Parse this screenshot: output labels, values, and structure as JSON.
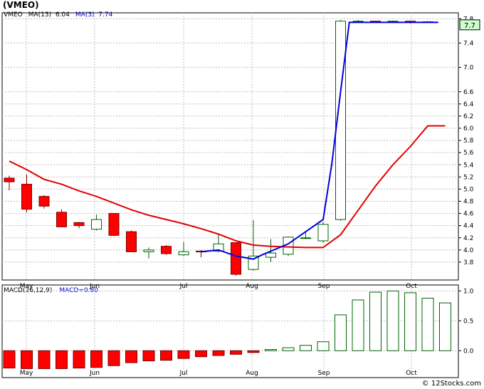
{
  "ticker": "(VMEO)",
  "legend": {
    "symbol": "VMEO",
    "ma13_label": "MA(13)",
    "ma13_value": "6.04",
    "ma3_label": "MA(3)",
    "ma3_value": "7.74",
    "last_price_label": "7.7"
  },
  "macd_legend": {
    "label": "MACD(26,12,9)",
    "value_label": "MACD=0.80"
  },
  "credit": "© 12Stocks.com",
  "colors": {
    "up_candle": "#ffffff",
    "up_border": "#006400",
    "down_candle": "#ff0000",
    "down_border": "#800000",
    "ma13": "#e00000",
    "ma3": "#0000dd",
    "grid": "#c0c0c0",
    "macd_neg": "#ff0000",
    "macd_pos": "#ffffff",
    "price_label_bg": "#ccffcc"
  },
  "chart_data": [
    {
      "type": "candlestick",
      "title": "VMEO",
      "ylim": [
        3.6,
        7.85
      ],
      "y_ticks": [
        3.8,
        4.0,
        4.2,
        4.4,
        4.6,
        4.8,
        5.0,
        5.2,
        5.4,
        5.6,
        5.8,
        6.0,
        6.2,
        6.4,
        6.6,
        7.0,
        7.4,
        7.8
      ],
      "x_ticks": [
        "May",
        "Jun",
        "Jul",
        "Aug",
        "Sep",
        "Oct"
      ],
      "x_tick_index": [
        1.1,
        5.1,
        10.1,
        14.1,
        18.1,
        23.1
      ],
      "candles": [
        {
          "o": 5.18,
          "h": 5.22,
          "l": 4.98,
          "c": 5.12
        },
        {
          "o": 5.08,
          "h": 5.24,
          "l": 4.62,
          "c": 4.67
        },
        {
          "o": 4.88,
          "h": 4.9,
          "l": 4.68,
          "c": 4.72
        },
        {
          "o": 4.62,
          "h": 4.67,
          "l": 4.38,
          "c": 4.38
        },
        {
          "o": 4.45,
          "h": 4.46,
          "l": 4.36,
          "c": 4.4
        },
        {
          "o": 4.34,
          "h": 4.58,
          "l": 4.32,
          "c": 4.5
        },
        {
          "o": 4.6,
          "h": 4.6,
          "l": 4.23,
          "c": 4.24
        },
        {
          "o": 4.3,
          "h": 4.32,
          "l": 3.97,
          "c": 3.97
        },
        {
          "o": 3.97,
          "h": 4.04,
          "l": 3.86,
          "c": 4.0
        },
        {
          "o": 4.06,
          "h": 4.08,
          "l": 3.92,
          "c": 3.94
        },
        {
          "o": 3.92,
          "h": 4.13,
          "l": 3.9,
          "c": 3.97
        },
        {
          "o": 3.98,
          "h": 4.0,
          "l": 3.88,
          "c": 3.97
        },
        {
          "o": 3.98,
          "h": 4.27,
          "l": 3.96,
          "c": 4.1
        },
        {
          "o": 4.12,
          "h": 4.12,
          "l": 3.58,
          "c": 3.6
        },
        {
          "o": 3.68,
          "h": 4.49,
          "l": 3.66,
          "c": 3.9
        },
        {
          "o": 3.88,
          "h": 4.18,
          "l": 3.8,
          "c": 3.95
        },
        {
          "o": 3.93,
          "h": 4.22,
          "l": 3.9,
          "c": 4.21
        },
        {
          "o": 4.2,
          "h": 4.3,
          "l": 4.18,
          "c": 4.2
        },
        {
          "o": 4.15,
          "h": 4.46,
          "l": 4.12,
          "c": 4.42
        },
        {
          "o": 4.5,
          "h": 7.78,
          "l": 4.48,
          "c": 7.76
        },
        {
          "o": 7.76,
          "h": 7.78,
          "l": 7.74,
          "c": 7.76
        },
        {
          "o": 7.76,
          "h": 7.76,
          "l": 7.74,
          "c": 7.75
        },
        {
          "o": 7.75,
          "h": 7.77,
          "l": 7.74,
          "c": 7.76
        },
        {
          "o": 7.76,
          "h": 7.76,
          "l": 7.72,
          "c": 7.74
        },
        {
          "o": 7.75,
          "h": 7.76,
          "l": 7.74,
          "c": 7.75
        }
      ],
      "series": [
        {
          "name": "MA(13)",
          "color": "#e00000",
          "x": [
            0,
            1,
            2,
            3,
            4,
            5,
            6,
            7,
            8,
            9,
            10,
            11,
            12,
            13,
            14,
            15,
            16,
            17,
            18,
            19,
            20,
            21,
            22,
            23,
            24,
            25
          ],
          "values": [
            5.46,
            5.32,
            5.16,
            5.08,
            4.97,
            4.88,
            4.77,
            4.66,
            4.57,
            4.5,
            4.43,
            4.35,
            4.26,
            4.15,
            4.08,
            4.06,
            4.05,
            4.04,
            4.04,
            4.25,
            4.65,
            5.05,
            5.4,
            5.7,
            6.04,
            6.04
          ]
        },
        {
          "name": "MA(3)",
          "color": "#0000dd",
          "x": [
            11,
            12,
            13,
            14,
            14.5,
            15,
            16,
            17,
            17.5,
            18,
            18.5,
            19,
            19.5,
            20,
            20.5,
            21,
            22,
            23,
            24,
            24.6
          ],
          "values": [
            3.97,
            4.0,
            3.9,
            3.85,
            3.92,
            3.98,
            4.1,
            4.3,
            4.4,
            4.5,
            5.42,
            6.6,
            7.74,
            7.74,
            7.74,
            7.74,
            7.74,
            7.74,
            7.74,
            7.74
          ]
        }
      ],
      "ma3_start_index": 11,
      "last_price": 7.7
    },
    {
      "type": "bar",
      "title": "MACD(26,12,9)",
      "ylim": [
        -0.45,
        1.1
      ],
      "y_ticks": [
        0.0,
        0.5,
        1.0
      ],
      "x_ticks": [
        "May",
        "Jun",
        "Jul",
        "Aug",
        "Sep",
        "Oct"
      ],
      "values": [
        -0.29,
        -0.3,
        -0.3,
        -0.3,
        -0.29,
        -0.28,
        -0.25,
        -0.2,
        -0.17,
        -0.16,
        -0.13,
        -0.1,
        -0.08,
        -0.06,
        -0.03,
        0.02,
        0.05,
        0.09,
        0.15,
        0.6,
        0.85,
        0.98,
        1.0,
        0.97,
        0.88,
        0.8
      ]
    }
  ]
}
